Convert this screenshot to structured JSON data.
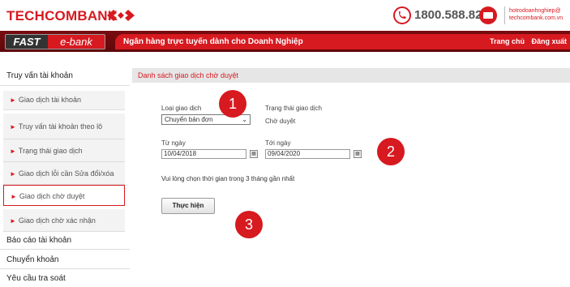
{
  "header": {
    "brand": "TECHCOMBANK",
    "hotline": "1800.588.822",
    "contact_email": "hotrodoanhnghiep@",
    "contact_site": "techcombank.com.vn",
    "accent_color": "#d71920"
  },
  "band": {
    "logo_fast": "FAST",
    "logo_ebank": "e-bank",
    "tagline": "Ngân hàng trực tuyến dành cho Doanh Nghiệp",
    "nav_home": "Trang chủ",
    "nav_logout": "Đăng xuất"
  },
  "sidebar": {
    "section1": "Truy vấn tài khoản",
    "items": [
      {
        "label": "Giao dịch tài khoản"
      },
      {
        "label": "Truy vấn tài khoản theo lô"
      },
      {
        "label": "Trạng thái giao dịch"
      },
      {
        "label": "Giao dịch lỗi cần Sửa đổi/xóa"
      },
      {
        "label": "Giao dịch chờ duyệt"
      },
      {
        "label": "Giao dịch chờ xác nhận"
      }
    ],
    "section2": "Báo cáo tài khoản",
    "section3": "Chuyển khoản",
    "section4": "Yêu cầu tra soát"
  },
  "main": {
    "title": "Danh sách giao dịch chờ duyệt",
    "type_label": "Loại giao dịch",
    "type_value": "Chuyển bản đơn",
    "status_label": "Trạng thái giao dịch",
    "status_value": "Chờ duyệt",
    "from_label": "Từ ngày",
    "from_value": "10/04/2018",
    "to_label": "Tới ngày",
    "to_value": "09/04/2020",
    "note": "Vui lòng chọn thời gian trong 3 tháng gần nhất",
    "submit": "Thực hiện"
  },
  "callouts": [
    "1",
    "2",
    "3"
  ]
}
